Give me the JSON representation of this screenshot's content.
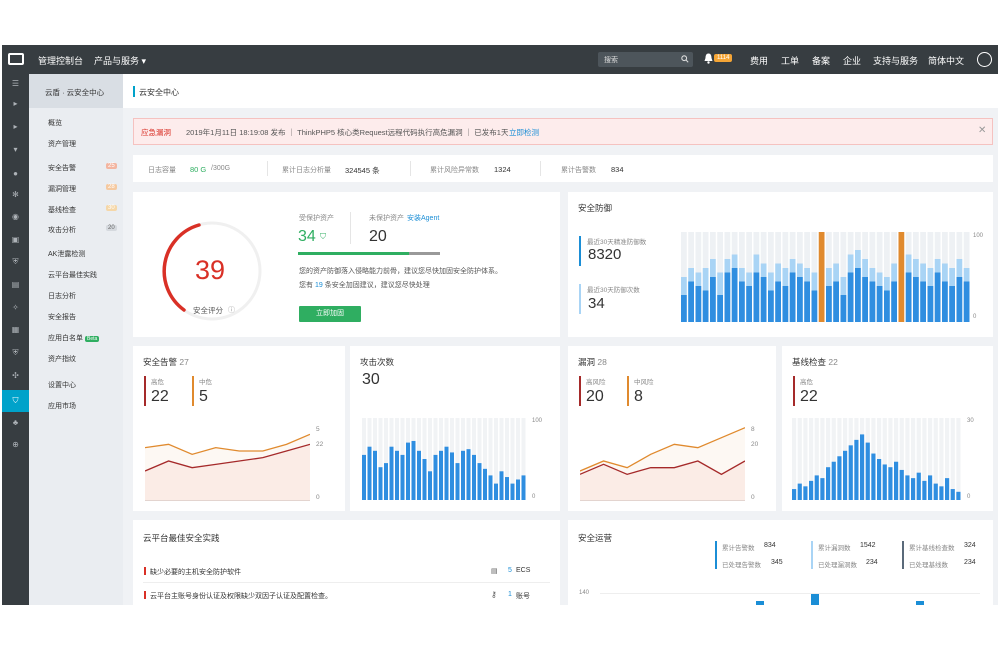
{
  "topbar": {
    "console": "管理控制台",
    "products": "产品与服务 ▾",
    "search_placeholder": "搜索",
    "badge": "1114",
    "links": [
      "费用",
      "工单",
      "备案",
      "企业",
      "支持与服务",
      "简体中文"
    ]
  },
  "sidebar": {
    "header": "云盾 · 云安全中心",
    "items": [
      {
        "label": "概览"
      },
      {
        "label": "资产管理"
      },
      {
        "label": "安全告警",
        "count": "25"
      },
      {
        "label": "漏洞管理",
        "count": "28"
      },
      {
        "label": "基线检查",
        "count": "30"
      },
      {
        "label": "攻击分析",
        "count": "20"
      },
      {
        "label": "AK泄露检测"
      },
      {
        "label": "云平台最佳实践"
      },
      {
        "label": "日志分析"
      },
      {
        "label": "安全报告"
      },
      {
        "label": "应用白名单",
        "beta": "Beta"
      },
      {
        "label": "资产指纹"
      },
      {
        "label": "设置中心"
      },
      {
        "label": "应用市场"
      }
    ]
  },
  "page": {
    "title": "云安全中心"
  },
  "alert": {
    "tag": "应急漏洞",
    "text": "2019年1月11日 18:19:08 发布  ｜  ThinkPHP5 核心类Request远程代码执行高危漏洞  ｜  已发布1天",
    "action": "立即检测"
  },
  "stats": [
    {
      "label": "日志容量",
      "value": "80 G",
      "extra": "/300G"
    },
    {
      "label": "累计日志分析量",
      "value": "324545 条"
    },
    {
      "label": "累计风险异常数",
      "value": "1324"
    },
    {
      "label": "累计告警数",
      "value": "834"
    }
  ],
  "score": {
    "value": "39",
    "label": "安全评分",
    "protected_label": "受保护资产",
    "protected_value": "34",
    "unprotected_label": "未保护资产",
    "install_agent": "安装Agent",
    "unprotected_value": "20",
    "desc1": "您的资产防御落入侵略能力前骨，建议您尽快加固安全防护体系。",
    "desc2_pre": "您有",
    "desc2_num": "19",
    "desc2_post": "条安全加固建议，建议您尽快处理",
    "button": "立即加固"
  },
  "defense": {
    "title": "安全防御",
    "stat1_label": "最近30天精准防御数",
    "stat1_value": "8320",
    "stat2_label": "最近30天防御次数",
    "stat2_value": "34",
    "axis_top": "100",
    "axis_bottom": "0"
  },
  "alerts_card": {
    "title": "安全告警",
    "total": "27",
    "high_label": "高危",
    "high_value": "22",
    "mid_label": "中危",
    "mid_value": "5",
    "right_top": "5",
    "right_mid": "22",
    "right_bottom": "0"
  },
  "attack_card": {
    "title": "攻击次数",
    "value": "30",
    "axis_top": "100",
    "axis_bottom": "0"
  },
  "vuln_card": {
    "title": "漏洞",
    "total": "28",
    "high_label": "高风险",
    "high_value": "20",
    "mid_label": "中风险",
    "mid_value": "8",
    "right_top": "8",
    "right_mid": "20",
    "right_bottom": "0"
  },
  "baseline_card": {
    "title": "基线检查",
    "total": "22",
    "high_label": "高危",
    "high_value": "22",
    "axis_top": "30",
    "axis_bottom": "0"
  },
  "practice": {
    "title": "云平台最佳安全实践",
    "items": [
      {
        "text": "缺少必要的主机安全防护软件",
        "count": "5",
        "unit": "ECS"
      },
      {
        "text": "云平台主账号身份认证及权限缺少双因子认证及配置检查。",
        "count": "1",
        "unit": "账号"
      }
    ]
  },
  "ops": {
    "title": "安全运营",
    "groups": [
      {
        "l1": "累计告警数",
        "v1": "834",
        "l2": "已处理告警数",
        "v2": "345"
      },
      {
        "l1": "累计漏洞数",
        "v1": "1542",
        "l2": "已处理漏洞数",
        "v2": "234"
      },
      {
        "l1": "累计基线检查数",
        "v1": "324",
        "l2": "已处理基线数",
        "v2": "234"
      }
    ],
    "axis_top": "140"
  },
  "colors": {
    "accent": "#00a2ca",
    "blue": "#1b8ed6",
    "bar": "#2f8ee0",
    "bar_light": "#a9d4f5",
    "orange": "#e08a2e",
    "red": "#d93026",
    "green": "#2fae61",
    "topbar": "#373d41"
  },
  "chart_data": [
    {
      "type": "bar",
      "title": "安全防御",
      "ylim": [
        0,
        100
      ],
      "x": [
        1,
        2,
        3,
        4,
        5,
        6,
        7,
        8,
        9,
        10,
        11,
        12,
        13,
        14,
        15,
        16,
        17,
        18,
        19,
        20,
        21,
        22,
        23,
        24,
        25,
        26,
        27,
        28,
        29,
        30,
        31,
        32,
        33,
        34,
        35,
        36,
        37,
        38,
        39,
        40
      ],
      "series": [
        {
          "values": [
            30,
            45,
            40,
            35,
            50,
            30,
            55,
            60,
            45,
            40,
            55,
            50,
            35,
            45,
            40,
            55,
            50,
            45,
            35,
            100,
            40,
            45,
            30,
            55,
            60,
            50,
            45,
            40,
            35,
            45,
            100,
            55,
            50,
            45,
            40,
            55,
            45,
            40,
            50,
            45
          ]
        },
        {
          "values": [
            50,
            60,
            55,
            60,
            70,
            55,
            70,
            75,
            60,
            55,
            75,
            65,
            55,
            65,
            60,
            70,
            65,
            60,
            55,
            100,
            60,
            65,
            50,
            75,
            80,
            70,
            60,
            55,
            50,
            65,
            100,
            75,
            70,
            65,
            60,
            70,
            65,
            60,
            70,
            60
          ]
        }
      ]
    },
    {
      "type": "line",
      "title": "安全告警",
      "x": [
        1,
        2,
        3,
        4,
        5,
        6,
        7,
        8
      ],
      "series": [
        {
          "name": "中危",
          "values": [
            16,
            17,
            14,
            16,
            15,
            15,
            17,
            20
          ]
        },
        {
          "name": "高危",
          "values": [
            9,
            12,
            10,
            11,
            12,
            13,
            15,
            17
          ]
        }
      ]
    },
    {
      "type": "bar",
      "title": "攻击次数",
      "ylim": [
        0,
        100
      ],
      "x": [
        1,
        2,
        3,
        4,
        5,
        6,
        7,
        8,
        9,
        10,
        11,
        12,
        13,
        14,
        15,
        16,
        17,
        18,
        19,
        20,
        21,
        22,
        23,
        24,
        25,
        26,
        27,
        28,
        29,
        30
      ],
      "values": [
        55,
        65,
        60,
        40,
        45,
        65,
        60,
        55,
        70,
        72,
        60,
        50,
        35,
        55,
        60,
        65,
        58,
        45,
        60,
        62,
        55,
        45,
        38,
        30,
        20,
        35,
        28,
        20,
        25,
        30
      ]
    },
    {
      "type": "line",
      "title": "漏洞",
      "x": [
        1,
        2,
        3,
        4,
        5,
        6,
        7,
        8
      ],
      "series": [
        {
          "name": "中风险",
          "values": [
            9,
            12,
            10,
            14,
            17,
            16,
            19,
            22
          ]
        },
        {
          "name": "高风险",
          "values": [
            8,
            11,
            8,
            10,
            10,
            12,
            8,
            12
          ]
        }
      ]
    },
    {
      "type": "bar",
      "title": "基线检查",
      "ylim": [
        0,
        30
      ],
      "x": [
        1,
        2,
        3,
        4,
        5,
        6,
        7,
        8,
        9,
        10,
        11,
        12,
        13,
        14,
        15,
        16,
        17,
        18,
        19,
        20,
        21,
        22,
        23,
        24,
        25,
        26,
        27,
        28,
        29,
        30
      ],
      "values": [
        4,
        6,
        5,
        7,
        9,
        8,
        12,
        14,
        16,
        18,
        20,
        22,
        24,
        21,
        17,
        15,
        13,
        12,
        14,
        11,
        9,
        8,
        10,
        7,
        9,
        6,
        5,
        8,
        4,
        3
      ]
    }
  ]
}
